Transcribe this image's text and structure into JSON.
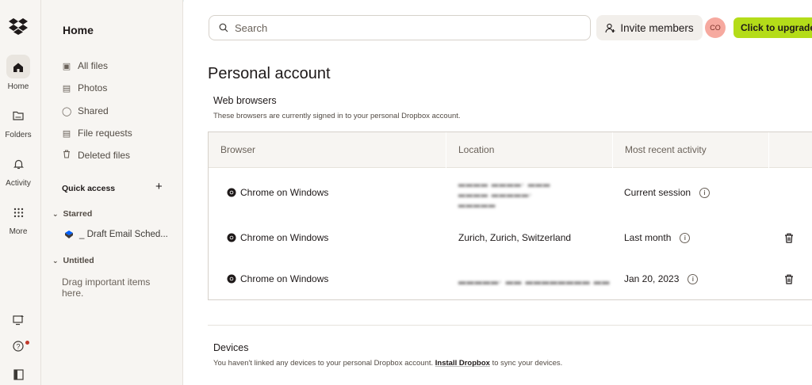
{
  "rail": {
    "items": [
      {
        "label": "Home",
        "icon": "home-icon",
        "active": true
      },
      {
        "label": "Folders",
        "icon": "folder-icon"
      },
      {
        "label": "Activity",
        "icon": "bell-icon"
      },
      {
        "label": "More",
        "icon": "grid-icon"
      }
    ]
  },
  "sidebar": {
    "title": "Home",
    "nav": [
      {
        "label": "All files",
        "icon": "all-files-icon"
      },
      {
        "label": "Photos",
        "icon": "photos-icon"
      },
      {
        "label": "Shared",
        "icon": "shared-icon"
      },
      {
        "label": "File requests",
        "icon": "file-request-icon"
      },
      {
        "label": "Deleted files",
        "icon": "trash-icon"
      }
    ],
    "quick_access": "Quick access",
    "starred": {
      "label": "Starred",
      "items": [
        "_ Draft Email Sched..."
      ]
    },
    "untitled": {
      "label": "Untitled",
      "hint": "Drag important items here."
    }
  },
  "header": {
    "search_placeholder": "Search",
    "invite_label": "Invite members",
    "avatar_initials": "CO",
    "upgrade_label": "Click to upgrade"
  },
  "page": {
    "title": "Personal account",
    "web_browsers": {
      "title": "Web browsers",
      "description": "These browsers are currently signed in to your personal Dropbox account.",
      "columns": [
        "Browser",
        "Location",
        "Most recent activity"
      ],
      "rows": [
        {
          "browser": "Chrome on Windows",
          "location": "",
          "activity": "Current session",
          "deletable": false
        },
        {
          "browser": "Chrome on Windows",
          "location": "Zurich, Zurich, Switzerland",
          "activity": "Last month",
          "deletable": true
        },
        {
          "browser": "Chrome on Windows",
          "location": "",
          "activity": "Jan 20, 2023",
          "deletable": true
        }
      ]
    },
    "devices": {
      "title": "Devices",
      "description_before": "You haven't linked any devices to your personal Dropbox account.",
      "link": "Install Dropbox",
      "description_after": "to sync your devices."
    }
  },
  "colors": {
    "upgrade": "#b4dc19",
    "avatar": "#f6a99f",
    "dropbox_blue": "#0061fe"
  }
}
